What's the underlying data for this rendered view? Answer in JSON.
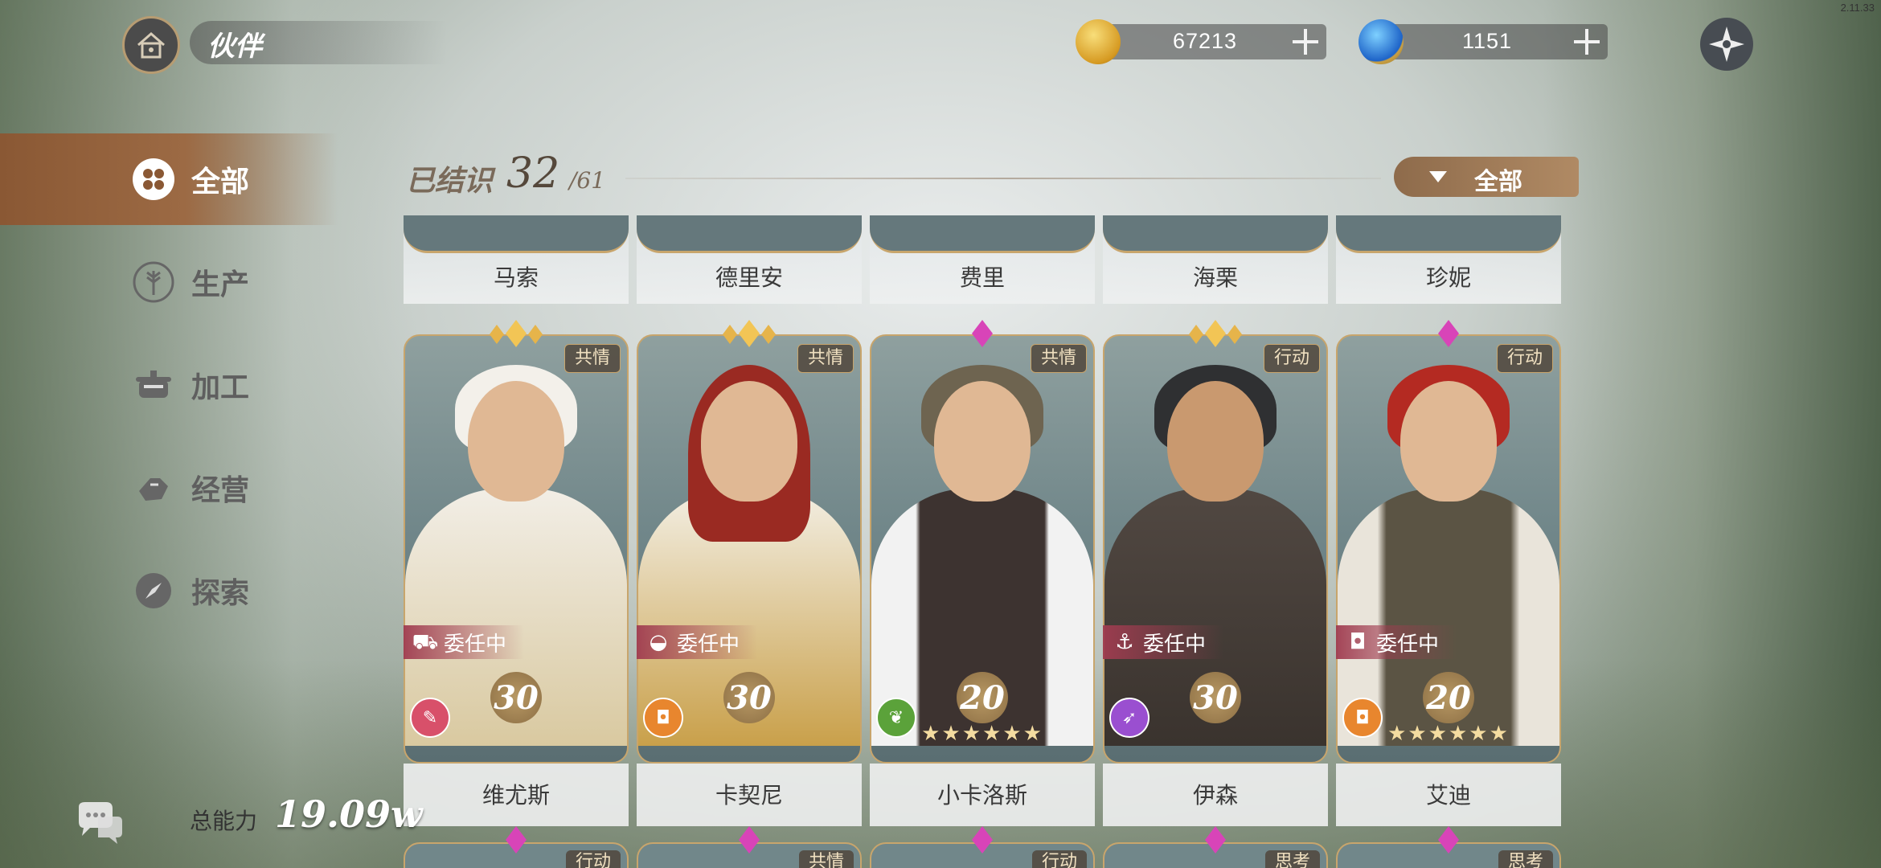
{
  "version": "2.11.33",
  "header": {
    "title": "伙伴"
  },
  "currencies": [
    {
      "name": "gold",
      "value": "67213",
      "icon": "gold-coin-icon",
      "color": "#e4b33a"
    },
    {
      "name": "gem",
      "value": "1151",
      "icon": "blue-gem-icon",
      "color": "#2c6fd6"
    }
  ],
  "sidebar": {
    "items": [
      {
        "label": "全部",
        "icon": "grid-icon",
        "active": true
      },
      {
        "label": "生产",
        "icon": "wheat-icon",
        "active": false
      },
      {
        "label": "加工",
        "icon": "pot-icon",
        "active": false
      },
      {
        "label": "经营",
        "icon": "hand-icon",
        "active": false
      },
      {
        "label": "探索",
        "icon": "compass-icon",
        "active": false
      }
    ]
  },
  "roster": {
    "known_label": "已结识",
    "known_count": "32",
    "known_total": "/61",
    "filter_label": "全部"
  },
  "top_row": {
    "names": [
      "马索",
      "德里安",
      "费里",
      "海栗",
      "珍妮"
    ]
  },
  "cards": [
    {
      "name": "维尤斯",
      "tag": "共情",
      "status": "委任中",
      "status_icon": "cart-icon",
      "level": "30",
      "type_icon": "scroll-icon",
      "type_color": "#d8506a",
      "gem": "gold",
      "stars": ""
    },
    {
      "name": "卡契尼",
      "tag": "共情",
      "status": "委任中",
      "status_icon": "bowl-icon",
      "level": "30",
      "type_icon": "pot-icon",
      "type_color": "#e8862e",
      "gem": "gold",
      "stars": ""
    },
    {
      "name": "小卡洛斯",
      "tag": "共情",
      "status": "",
      "status_icon": "",
      "level": "20",
      "type_icon": "wheat-icon",
      "type_color": "#5ba23a",
      "gem": "pink",
      "stars": "★★★★★★"
    },
    {
      "name": "伊森",
      "tag": "行动",
      "status": "委任中",
      "status_icon": "anchor-icon",
      "level": "30",
      "type_icon": "compass-icon",
      "type_color": "#9a4fd0",
      "gem": "gold",
      "stars": ""
    },
    {
      "name": "艾迪",
      "tag": "行动",
      "status": "委任中",
      "status_icon": "pot-icon",
      "level": "20",
      "type_icon": "pot-icon",
      "type_color": "#e8862e",
      "gem": "pink",
      "stars": "★★★★★★"
    }
  ],
  "bottom_row": {
    "tags": [
      "行动",
      "共情",
      "行动",
      "思考",
      "思考"
    ]
  },
  "footer": {
    "power_label": "总能力",
    "power_value": "19.09w"
  }
}
